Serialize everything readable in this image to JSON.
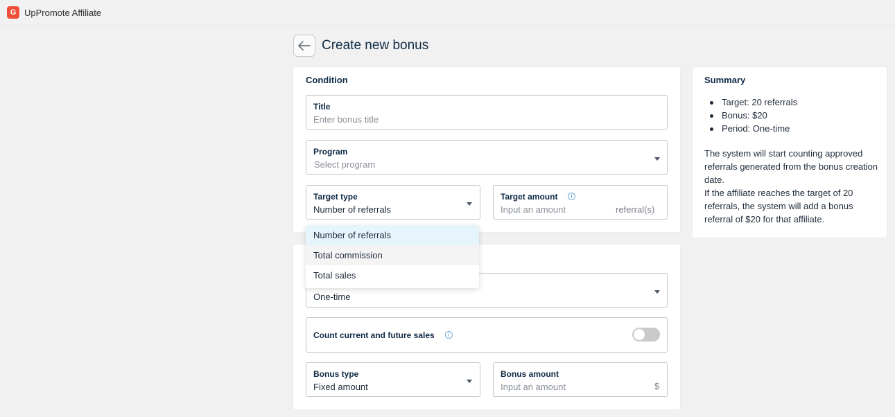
{
  "app": {
    "title": "UpPromote Affiliate",
    "logo_glyph": "G"
  },
  "page": {
    "title": "Create new bonus"
  },
  "condition": {
    "section_title": "Condition",
    "title_field": {
      "label": "Title",
      "placeholder": "Enter bonus title"
    },
    "program_field": {
      "label": "Program",
      "placeholder": "Select program"
    },
    "target_type": {
      "label": "Target type",
      "value": "Number of referrals"
    },
    "target_amount": {
      "label": "Target amount",
      "placeholder": "Input an amount",
      "suffix": "referral(s)"
    }
  },
  "target_type_dropdown": {
    "options": [
      "Number of referrals",
      "Total commission",
      "Total sales"
    ],
    "selected": "Number of referrals"
  },
  "bonus": {
    "period_value": "One-time",
    "count_sales": {
      "label": "Count current and future sales",
      "enabled": false
    },
    "bonus_type": {
      "label": "Bonus type",
      "value": "Fixed amount"
    },
    "bonus_amount": {
      "label": "Bonus amount",
      "placeholder": "Input an amount",
      "suffix": "$"
    }
  },
  "summary": {
    "title": "Summary",
    "items": [
      "Target: 20 referrals",
      "Bonus: $20",
      "Period: One-time"
    ],
    "paragraph_1": "The system will start counting approved referrals generated from the bonus creation date.",
    "paragraph_2": "If the affiliate reaches the target of 20 referrals, the system will add a bonus referral of $20 for that affiliate."
  },
  "colors": {
    "brand": "#ef4f3a",
    "text": "#0f2a44",
    "selected_option_bg": "#e6f4fb",
    "info": "#74a9d6"
  }
}
